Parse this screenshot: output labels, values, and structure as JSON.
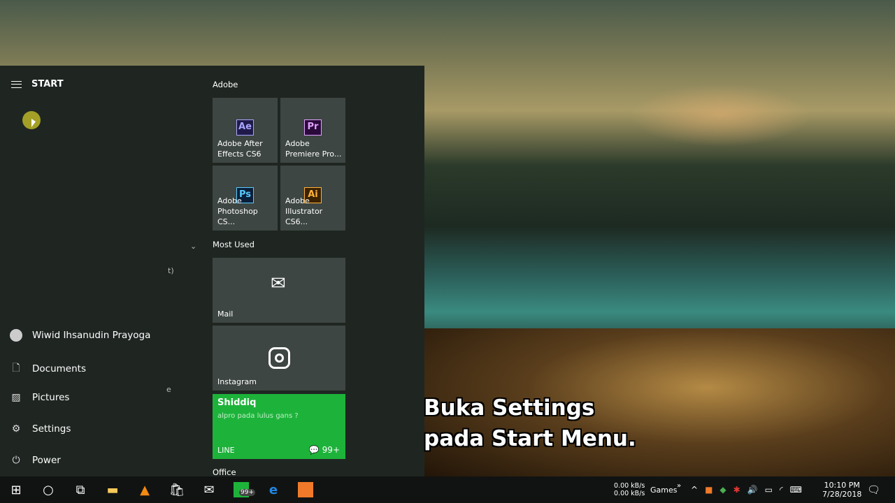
{
  "start": {
    "title": "START",
    "user": "Wiwid Ihsanudin Prayoga",
    "nav": [
      "Documents",
      "Pictures",
      "Settings",
      "Power"
    ],
    "stray": [
      "t)",
      "e"
    ]
  },
  "groups": {
    "adobe": "Adobe",
    "most_used": "Most Used",
    "office": "Office"
  },
  "tiles": {
    "ae": {
      "abbr": "Ae",
      "l1": "Adobe After",
      "l2": "Effects CS6"
    },
    "pr": {
      "abbr": "Pr",
      "l1": "Adobe",
      "l2": "Premiere Pro..."
    },
    "ps": {
      "abbr": "Ps",
      "l1": "Adobe",
      "l2": "Photoshop CS..."
    },
    "ai": {
      "abbr": "Ai",
      "l1": "Adobe",
      "l2": "Illustrator CS6..."
    },
    "mail": "Mail",
    "instagram": "Instagram",
    "line": {
      "sender": "Shiddiq",
      "message": "alpro pada lulus gans ?",
      "app": "LINE",
      "count": "99+"
    }
  },
  "taskbar": {
    "badge": "99+",
    "net_up": "0.00 kB/s",
    "net_down": "0.00 kB/s",
    "toolbar": "Games",
    "time": "10:10 PM",
    "date": "7/28/2018"
  },
  "caption": {
    "line1": "Buka Settings",
    "line2": "pada Start Menu."
  }
}
